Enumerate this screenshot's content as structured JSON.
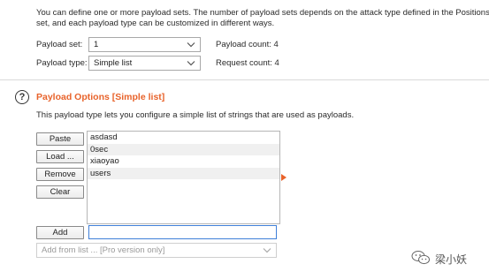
{
  "payload_sets": {
    "description_line1": "You can define one or more payload sets. The number of payload sets depends on the attack type defined in the Positions",
    "description_line2": "set, and each payload type can be customized in different ways.",
    "set_label": "Payload set:",
    "set_value": "1",
    "count_label": "Payload count: 4",
    "type_label": "Payload type:",
    "type_value": "Simple list",
    "request_label": "Request count: 4"
  },
  "payload_options": {
    "help_glyph": "?",
    "title": "Payload Options [Simple list]",
    "description": "This payload type lets you configure a simple list of strings that are used as payloads.",
    "buttons": {
      "paste": "Paste",
      "load": "Load ...",
      "remove": "Remove",
      "clear": "Clear",
      "add": "Add"
    },
    "items": [
      "asdasd",
      "0sec",
      "xiaoyao",
      "users"
    ],
    "add_input_value": "",
    "add_from_list": "Add from list ... [Pro version only]"
  },
  "watermark": {
    "text": "梁小妖"
  },
  "colors": {
    "accent": "#e8632b",
    "border": "#b6b6b6"
  }
}
